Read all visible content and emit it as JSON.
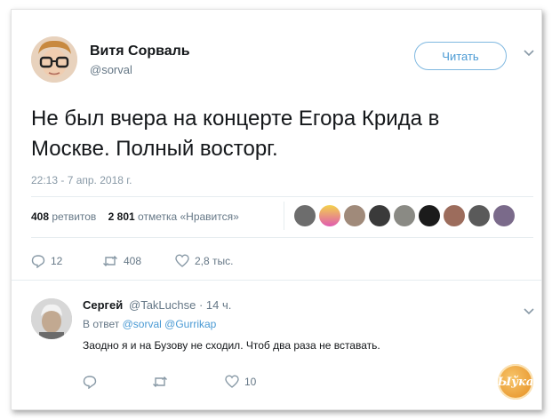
{
  "tweet": {
    "author_name": "Витя Сорваль",
    "author_handle": "@sorval",
    "follow_label": "Читать",
    "text_line1": "Не был вчера на концерте Егора Крида в",
    "text_line2": "Москве. Полный восторг.",
    "timestamp": "22:13 - 7 апр. 2018 г.",
    "retweets_count": "408",
    "retweets_label": "ретвитов",
    "likes_count": "2 801",
    "likes_label": "отметка «Нравится»",
    "actions": {
      "replies": "12",
      "retweets": "408",
      "likes": "2,8 тыс."
    }
  },
  "reply": {
    "author_name": "Сергей",
    "author_handle": "@TakLuchse · 14 ч.",
    "reply_to_prefix": "В ответ",
    "reply_to_1": "@sorval",
    "reply_to_2": "@Gurrikap",
    "text": "Заодно я и на Бузову не сходил. Чтоб два раза не вставать.",
    "actions": {
      "replies": "",
      "retweets": "",
      "likes": "10"
    }
  },
  "watermark": "Ыўка",
  "colors": {
    "accent": "#4a9ad4",
    "muted": "#657786",
    "text": "#14171a"
  }
}
